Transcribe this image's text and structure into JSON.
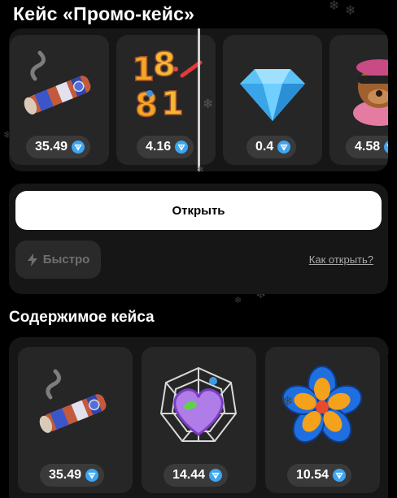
{
  "case": {
    "title": "Кейс «Промо-кейс»"
  },
  "roulette": {
    "items": [
      {
        "name": "cigar",
        "price": "35.49",
        "icon": "cigar-icon"
      },
      {
        "name": "numbers",
        "price": "4.16",
        "icon": "numbers-icon"
      },
      {
        "name": "diamond",
        "price": "0.4",
        "icon": "diamond-icon"
      },
      {
        "name": "dog",
        "price": "4.58",
        "icon": "dog-icon"
      }
    ]
  },
  "controls": {
    "open_label": "Открыть",
    "fast_label": "Быстро",
    "how_label": "Как открыть?"
  },
  "contents": {
    "title": "Содержимое кейса",
    "items": [
      {
        "name": "cigar",
        "price": "35.49",
        "icon": "cigar-icon"
      },
      {
        "name": "heart",
        "price": "14.44",
        "icon": "heart-icon"
      },
      {
        "name": "flower",
        "price": "10.54",
        "icon": "flower-icon"
      }
    ]
  },
  "currency_icon": "ton-icon",
  "colors": {
    "background": "#000000",
    "panel": "#161616",
    "card": "#262626",
    "pill": "#3a3a3a",
    "ton": "#3ea5f0"
  }
}
